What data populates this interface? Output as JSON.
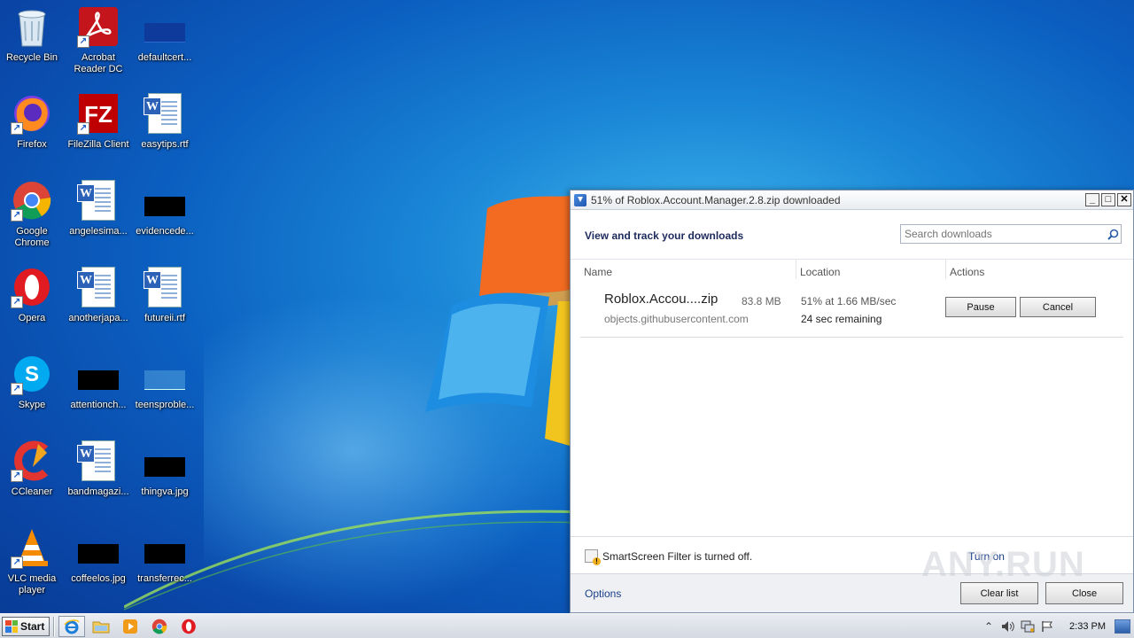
{
  "desktop": {
    "icons": [
      {
        "label": "Recycle Bin",
        "icon": "recycle-bin-icon"
      },
      {
        "label": "Acrobat Reader DC",
        "icon": "acrobat-icon"
      },
      {
        "label": "defaultcert...",
        "icon": "file-thumbnail-icon"
      },
      {
        "label": "Firefox",
        "icon": "firefox-icon"
      },
      {
        "label": "FileZilla Client",
        "icon": "filezilla-icon"
      },
      {
        "label": "easytips.rtf",
        "icon": "word-document-icon"
      },
      {
        "label": "Google Chrome",
        "icon": "chrome-icon"
      },
      {
        "label": "angelesima...",
        "icon": "word-document-icon"
      },
      {
        "label": "evidencede...",
        "icon": "image-thumbnail-icon"
      },
      {
        "label": "Opera",
        "icon": "opera-icon"
      },
      {
        "label": "anotherjapa...",
        "icon": "word-document-icon"
      },
      {
        "label": "futureii.rtf",
        "icon": "word-document-icon"
      },
      {
        "label": "Skype",
        "icon": "skype-icon"
      },
      {
        "label": "attentionch...",
        "icon": "image-thumbnail-icon"
      },
      {
        "label": "teensproble...",
        "icon": "file-thumbnail-icon"
      },
      {
        "label": "CCleaner",
        "icon": "ccleaner-icon"
      },
      {
        "label": "bandmagazi...",
        "icon": "word-document-icon"
      },
      {
        "label": "thingva.jpg",
        "icon": "image-thumbnail-icon"
      },
      {
        "label": "VLC media player",
        "icon": "vlc-icon"
      },
      {
        "label": "coffeelos.jpg",
        "icon": "image-thumbnail-icon"
      },
      {
        "label": "transferrec...",
        "icon": "image-thumbnail-icon"
      }
    ]
  },
  "download_window": {
    "title": "51% of Roblox.Account.Manager.2.8.zip downloaded",
    "headline": "View and track your downloads",
    "search_placeholder": "Search downloads",
    "columns": {
      "name": "Name",
      "location": "Location",
      "actions": "Actions"
    },
    "item": {
      "file_name": "Roblox.Accou....zip",
      "size": "83.8 MB",
      "source": "objects.githubusercontent.com",
      "progress": "51% at 1.66 MB/sec",
      "remaining": "24 sec remaining",
      "percent": 51
    },
    "buttons": {
      "pause": "Pause",
      "cancel": "Cancel",
      "clear_list": "Clear list",
      "close": "Close"
    },
    "smartscreen_text": "SmartScreen Filter is turned off.",
    "turn_on": "Turn on",
    "options": "Options"
  },
  "watermark": "ANY.RUN",
  "taskbar": {
    "start_label": "Start",
    "pinned": [
      "internet-explorer-icon",
      "explorer-folder-icon",
      "media-player-icon",
      "chrome-icon",
      "opera-icon"
    ],
    "clock": "2:33 PM"
  },
  "colors": {
    "accent": "#1d2a5c",
    "link": "#1a3e8a",
    "desktop_blue": "#0b5fc0"
  }
}
